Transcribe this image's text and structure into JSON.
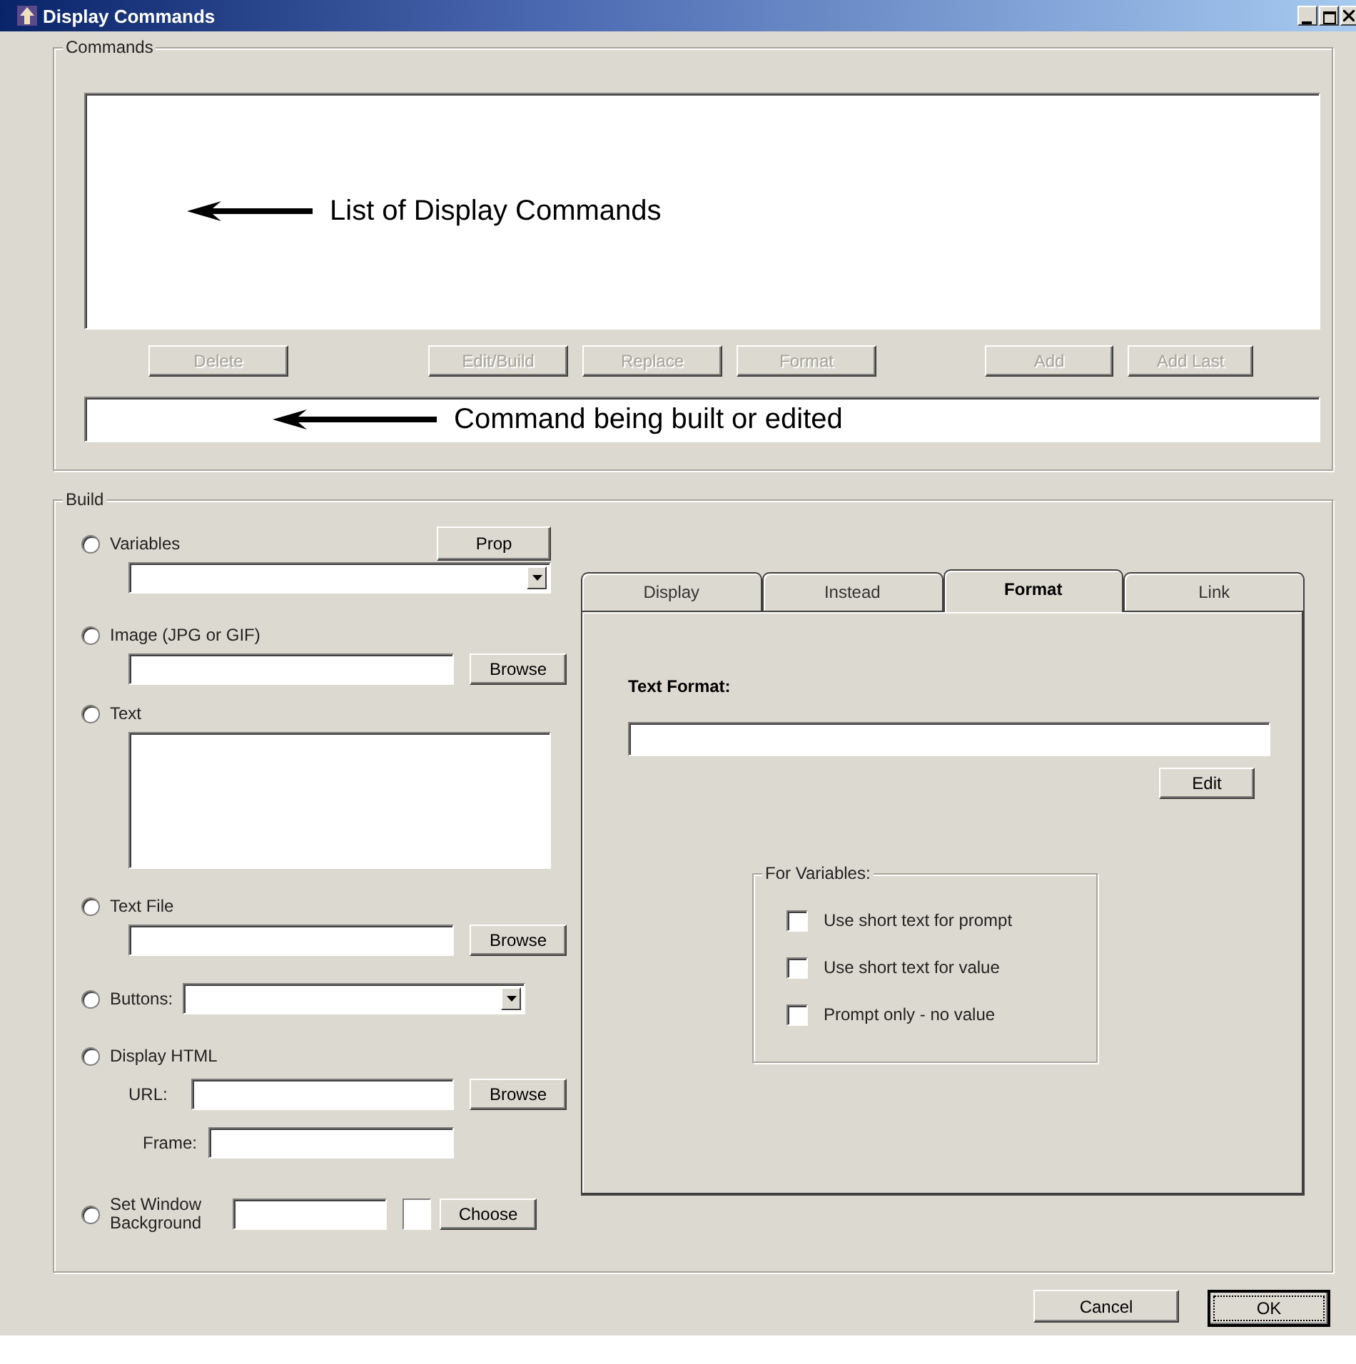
{
  "window": {
    "title": "Display Commands"
  },
  "commands": {
    "label": "Commands",
    "list_annotation": "List of Display Commands",
    "buttons": [
      {
        "label": "Delete",
        "disabled": true
      },
      {
        "label": "Edit/Build",
        "disabled": true
      },
      {
        "label": "Replace",
        "disabled": true
      },
      {
        "label": "Format",
        "disabled": true
      },
      {
        "label": "Add",
        "disabled": true
      },
      {
        "label": "Add Last",
        "disabled": true
      }
    ],
    "command_annotation": "Command being built or edited"
  },
  "build": {
    "label": "Build",
    "options": [
      {
        "kind": "combo",
        "label": "Variables",
        "selected": false,
        "button": "Prop"
      },
      {
        "kind": "file",
        "label": "Image (JPG or GIF)",
        "selected": false,
        "button": "Browse"
      },
      {
        "kind": "textarea",
        "label": "Text",
        "selected": false
      },
      {
        "kind": "file",
        "label": "Text File",
        "selected": false,
        "button": "Browse"
      },
      {
        "kind": "inline-combo",
        "label": "Buttons:",
        "selected": false
      },
      {
        "kind": "html",
        "label": "Display HTML",
        "selected": false,
        "url_label": "URL:",
        "frame_label": "Frame:",
        "button": "Browse"
      },
      {
        "kind": "color",
        "label": "Set Window Background",
        "selected": false,
        "button": "Choose"
      }
    ],
    "tabs": [
      {
        "label": "Display",
        "selected": false
      },
      {
        "label": "Instead",
        "selected": false
      },
      {
        "label": "Format",
        "selected": true
      },
      {
        "label": "Link",
        "selected": false
      }
    ],
    "format_panel": {
      "label": "Text Format:",
      "edit_button": "Edit",
      "group": {
        "label": "For Variables:",
        "options": [
          {
            "label": "Use short text for prompt",
            "checked": false
          },
          {
            "label": "Use short text for value",
            "checked": false
          },
          {
            "label": "Prompt only - no value",
            "checked": false
          }
        ]
      }
    }
  },
  "buttons": [
    {
      "label": "Cancel",
      "default": false
    },
    {
      "label": "OK",
      "default": true
    }
  ]
}
